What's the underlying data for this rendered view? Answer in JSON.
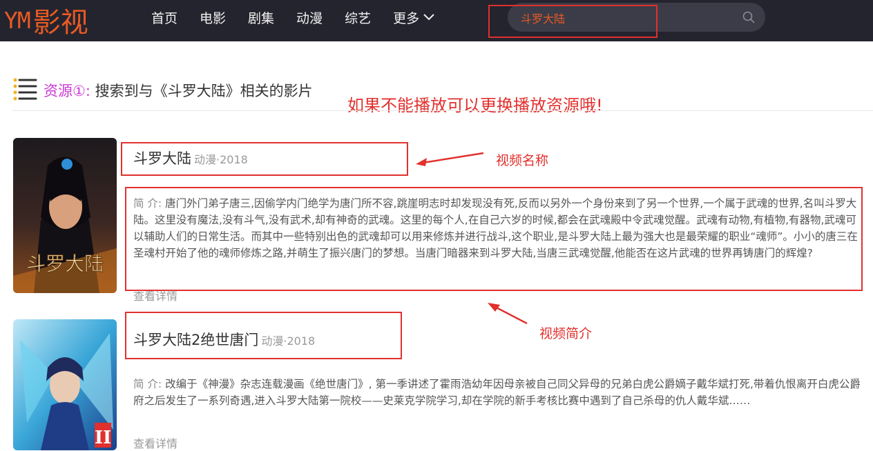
{
  "header": {
    "logo_ym": "YM",
    "logo_cn": "影视",
    "nav": [
      {
        "label": "首页"
      },
      {
        "label": "电影"
      },
      {
        "label": "剧集"
      },
      {
        "label": "动漫"
      },
      {
        "label": "综艺"
      },
      {
        "label": "更多"
      }
    ],
    "search_value": "斗罗大陆"
  },
  "section": {
    "source_label": "资源①:",
    "heading": "搜索到与《斗罗大陆》相关的影片"
  },
  "annotations": {
    "notice": "如果不能播放可以更换播放资源哦!",
    "video_name": "视频名称",
    "video_intro": "视频简介"
  },
  "results": [
    {
      "title": "斗罗大陆",
      "meta": "动漫·2018",
      "intro_label": "简 介:",
      "intro": "唐门外门弟子唐三,因偷学内门绝学为唐门所不容,跳崖明志时却发现没有死,反而以另外一个身份来到了另一个世界,一个属于武魂的世界,名叫斗罗大陆。这里没有魔法,没有斗气,没有武术,却有神奇的武魂。这里的每个人,在自己六岁的时候,都会在武魂殿中令武魂觉醒。武魂有动物,有植物,有器物,武魂可以辅助人们的日常生活。而其中一些特别出色的武魂却可以用来修炼并进行战斗,这个职业,是斗罗大陆上最为强大也是最荣耀的职业“魂师”。小小的唐三在圣魂村开始了他的魂师修炼之路,并萌生了振兴唐门的梦想。当唐门暗器来到斗罗大陆,当唐三武魂觉醒,他能否在这片武魂的世界再铸唐门的辉煌?",
      "more": "查看详情",
      "poster_text": "斗罗大陆"
    },
    {
      "title": "斗罗大陆2绝世唐门",
      "meta": "动漫·2018",
      "intro_label": "简 介:",
      "intro": "改编于《神漫》杂志连载漫画《绝世唐门》, 第一季讲述了霍雨浩幼年因母亲被自己同父异母的兄弟白虎公爵嫡子戴华斌打死,带着仇恨离开白虎公爵府之后发生了一系列奇遇,进入斗罗大陆第一院校——史莱克学院学习,却在学院的新手考核比赛中遇到了自己杀母的仇人戴华斌……",
      "more": "查看详情",
      "poster_text": "II"
    }
  ],
  "colors": {
    "header_bg": "#24242e",
    "brand": "#e85a24",
    "annotation_red": "#e1302d",
    "source_purple": "#c93ad3"
  }
}
